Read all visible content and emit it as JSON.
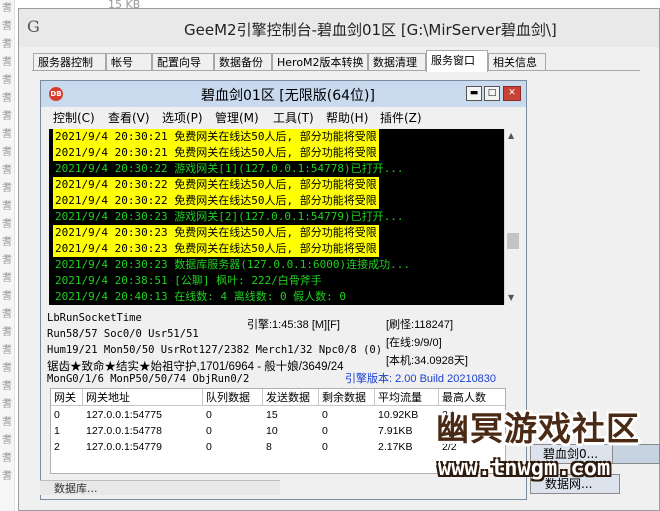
{
  "background": {
    "size_label": "15 KB",
    "left_column_glyph": "耆"
  },
  "outer_window": {
    "logo": "G",
    "title": "GeeM2引擎控制台-碧血剑01区 [G:\\MirServer碧血剑\\]",
    "tabs": [
      "服务器控制",
      "帐号",
      "配置向导",
      "数据备份",
      "HeroM2版本转换",
      "数据清理",
      "服务窗口",
      "相关信息"
    ],
    "active_tab": "服务窗口"
  },
  "inner_window": {
    "icon_label": "DB",
    "title": "碧血剑01区 [无限版(64位)]",
    "buttons": {
      "minimize": "▬",
      "maximize": "□",
      "close": "✕"
    },
    "menu": [
      "控制(C)",
      "查看(V)",
      "选项(P)",
      "管理(M)",
      "工具(T)",
      "帮助(H)",
      "插件(Z)"
    ],
    "log": [
      {
        "text": "2021/9/4 20:30:21 免费网关在线达50人后, 部分功能将受限",
        "style": "yellow"
      },
      {
        "text": "2021/9/4 20:30:21 免费网关在线达50人后, 部分功能将受限",
        "style": "yellow"
      },
      {
        "text": "2021/9/4 20:30:22 游戏网关[1](127.0.0.1:54778)已打开...",
        "style": "green"
      },
      {
        "text": "2021/9/4 20:30:22 免费网关在线达50人后, 部分功能将受限",
        "style": "yellow"
      },
      {
        "text": "2021/9/4 20:30:22 免费网关在线达50人后, 部分功能将受限",
        "style": "yellow"
      },
      {
        "text": "2021/9/4 20:30:23 游戏网关[2](127.0.0.1:54779)已打开...",
        "style": "green"
      },
      {
        "text": "2021/9/4 20:30:23 免费网关在线达50人后, 部分功能将受限",
        "style": "yellow"
      },
      {
        "text": "2021/9/4 20:30:23 免费网关在线达50人后, 部分功能将受限",
        "style": "yellow"
      },
      {
        "text": "2021/9/4 20:30:23 数据库服务器(127.0.0.1:6000)连接成功...",
        "style": "green"
      },
      {
        "text": "2021/9/4 20:38:51 [公聊] 枫叶: 222/白骨斧手",
        "style": "green"
      },
      {
        "text": "2021/9/4 20:40:13 在线数: 4 离线数: 0 假人数: 0",
        "style": "green"
      }
    ],
    "status": {
      "lb_run": "LbRunSocketTime",
      "run": "Run58/57 Soc0/0 Usr51/51",
      "hum": "Hum19/21 Mon50/50 UsrRot127/2382 Merch1/32 Npc0/8 (0)",
      "boss": "锯齿★致命★结实★始祖守护,1701/6964 - 般十娘/3649/24",
      "mon": "MonG0/1/6 MonP50/50/74 ObjRun0/2",
      "engine": "引擎:1:45:38 [M][F]",
      "refresh": "[刷怪:118247]",
      "online": "[在线:9/9/0]",
      "local": "[本机:34.0928天]",
      "version": "引擎版本: 2.00 Build 20210830",
      "version_color": "#1a3fd0"
    },
    "table": {
      "headers": [
        "网关",
        "网关地址",
        "队列数据",
        "发送数据",
        "剩余数据",
        "平均流量",
        "最高人数"
      ],
      "rows": [
        [
          "0",
          "127.0.0.1:54775",
          "0",
          "15",
          "0",
          "10.92KB",
          "2/2"
        ],
        [
          "1",
          "127.0.0.1:54778",
          "0",
          "10",
          "0",
          "7.91KB",
          "2/2"
        ],
        [
          "2",
          "127.0.0.1:54779",
          "0",
          "8",
          "0",
          "2.17KB",
          "2/2"
        ]
      ]
    }
  },
  "other_windows": {
    "item1": "碧血剑0...",
    "item2": "数据网...",
    "left_bottom": "数据库..."
  },
  "watermark": {
    "line1": "幽冥游戏社区",
    "line2": "www.tnwgm.com"
  }
}
